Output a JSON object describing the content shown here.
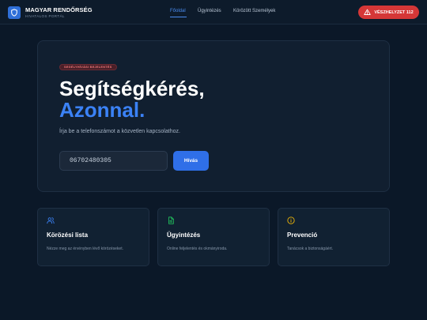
{
  "header": {
    "brand_title": "MAGYAR RENDŐRSÉG",
    "brand_subtitle": "HIVATALOS PORTÁL",
    "nav": [
      {
        "label": "Főoldal",
        "active": true
      },
      {
        "label": "Ügyintézés",
        "active": false
      },
      {
        "label": "Körözött Személyek",
        "active": false
      }
    ],
    "emergency_label": "VÉSZHELYZET 112",
    "emergency_icon": "warning-triangle-icon"
  },
  "hero": {
    "badge": "SEGÉLYHÍVÁSI BEJELENTÉS",
    "title_line1": "Segítségkérés,",
    "title_line2": "Azonnal.",
    "description": "Írja be a telefonszámot a közvetlen kapcsolathoz.",
    "phone_value": "06702480305",
    "call_label": "Hívás"
  },
  "cards": [
    {
      "title": "Körözési lista",
      "description": "Nézze meg az érvényben lévő körözéseket.",
      "icon": "users-icon",
      "icon_color": "#3b82f6"
    },
    {
      "title": "Ügyintézés",
      "description": "Online feljelentés és okmányiroda.",
      "icon": "document-icon",
      "icon_color": "#22c55e"
    },
    {
      "title": "Prevenció",
      "description": "Tanácsok a biztonságáért.",
      "icon": "info-circle-icon",
      "icon_color": "#eab308"
    }
  ],
  "colors": {
    "background": "#0b1828",
    "accent": "#3b82f6",
    "emergency": "#d53737"
  }
}
